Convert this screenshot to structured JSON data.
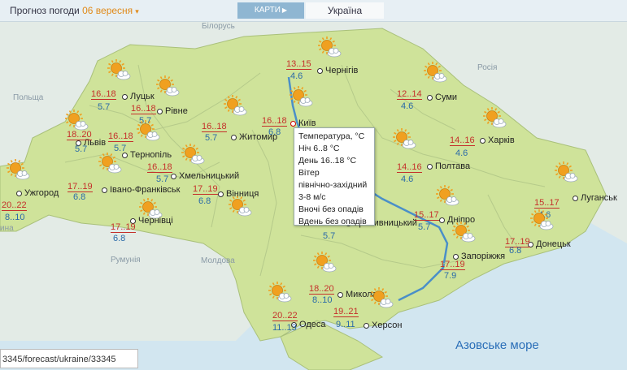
{
  "header": {
    "title": "Прогноз погоди",
    "date": "06 вересня",
    "maps_tab": "КАРТИ",
    "region_tab": "Україна"
  },
  "countries": {
    "belarus": "Білорусь",
    "poland": "Польща",
    "russia": "Росія",
    "romania": "Румунія",
    "moldova": "Молдова",
    "hungary": "ина"
  },
  "sea": "Азовське море",
  "cities": [
    {
      "name": "Ужгород",
      "day": "20..22",
      "night": "8..10"
    },
    {
      "name": "Луцьк",
      "day": "16..18",
      "night": "5.7"
    },
    {
      "name": "Рівне",
      "day": "16..18",
      "night": "5.7"
    },
    {
      "name": "Львів",
      "day": "18..20",
      "night": "5.7"
    },
    {
      "name": "Тернопіль",
      "day": "16..18",
      "night": "5.7"
    },
    {
      "name": "Хмельницький",
      "day": "16..18",
      "night": "5.7"
    },
    {
      "name": "Івано-Франківськ",
      "day": "17..19",
      "night": "6.8"
    },
    {
      "name": "Чернівці",
      "day": "17..19",
      "night": "6.8"
    },
    {
      "name": "Житомир",
      "day": "16..18",
      "night": "5.7"
    },
    {
      "name": "Вінниця",
      "day": "17..19",
      "night": "6.8"
    },
    {
      "name": "Київ",
      "day": "16..18",
      "night": "6.8"
    },
    {
      "name": "Чернігів",
      "day": "13..15",
      "night": "4.6"
    },
    {
      "name": "Суми",
      "day": "12..14",
      "night": "4.6"
    },
    {
      "name": "Харків",
      "day": "14..16",
      "night": "4.6"
    },
    {
      "name": "Полтава",
      "day": "14..16",
      "night": "4.6"
    },
    {
      "name": "Луганськ",
      "day": "15..17",
      "night": "4.6"
    },
    {
      "name": "Дніпро",
      "day": "15..17",
      "night": "5.7"
    },
    {
      "name": "Кропивницький",
      "day": "",
      "night": "5.7"
    },
    {
      "name": "Донецьк",
      "day": "17..19",
      "night": "6.8"
    },
    {
      "name": "Запоріжжя",
      "day": "17..19",
      "night": "7.9"
    },
    {
      "name": "Миколаїв",
      "day": "18..20",
      "night": "8..10"
    },
    {
      "name": "Одеса",
      "day": "20..22",
      "night": "11..13"
    },
    {
      "name": "Херсон",
      "day": "19..21",
      "night": "9..11"
    }
  ],
  "tooltip": {
    "line1": "Температура, °C",
    "line2": "Ніч 6..8 °C",
    "line3": "День 16..18 °C",
    "line4": "Вітер",
    "line5": "північно-західний",
    "line6": "3-8 м/с",
    "line7": "Вночі без опадів",
    "line8": "Вдень без опадів"
  },
  "status": "3345/forecast/ukraine/33345",
  "colors": {
    "land": "#cfe39a",
    "neighbor": "#e3ebe6",
    "water": "#d2e6f0",
    "sun": "#f0a020",
    "day_temp": "#c4302b",
    "night_temp": "#2a6aa8"
  }
}
